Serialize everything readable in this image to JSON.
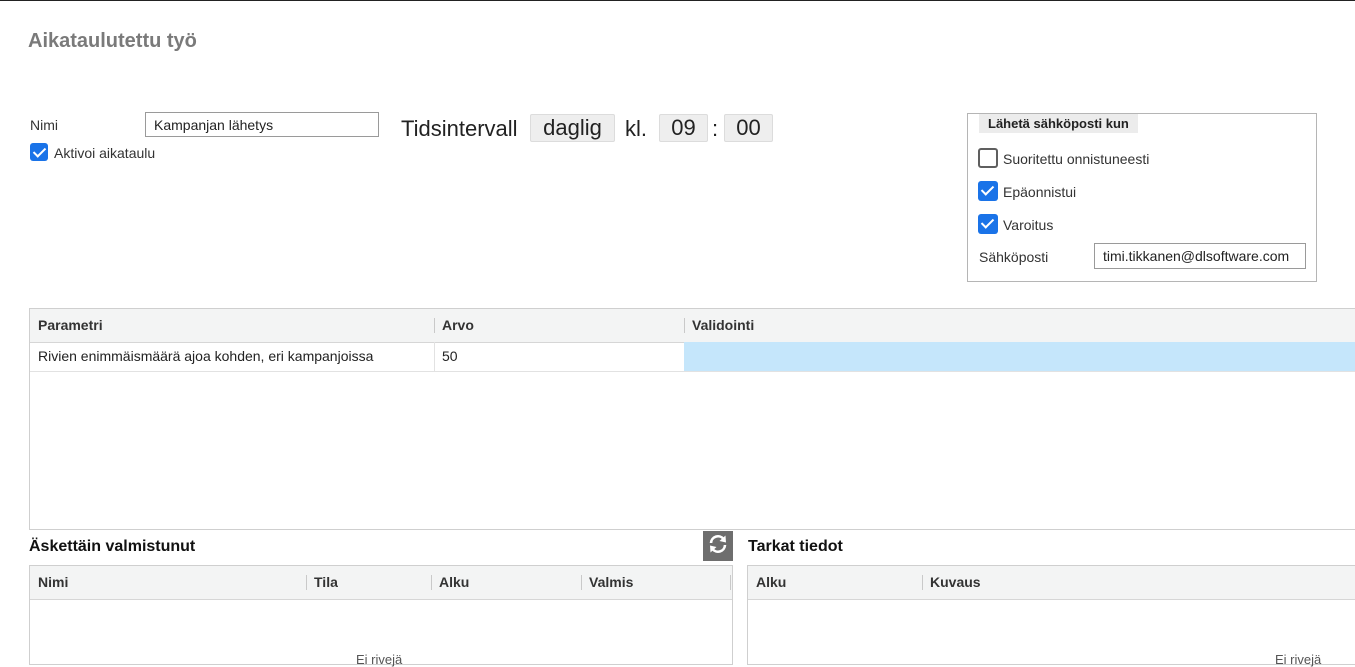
{
  "page": {
    "title": "Aikataulutettu työ"
  },
  "form": {
    "name_label": "Nimi",
    "name_value": "Kampanjan lähetys",
    "activate_label": "Aktivoi aikataulu",
    "activate_checked": true
  },
  "interval": {
    "label": "Tidsintervall",
    "frequency": "daglig",
    "time_label": "kl.",
    "hour": "09",
    "separator": ":",
    "minute": "00"
  },
  "email_group": {
    "legend": "Lähetä sähköposti kun",
    "options": [
      {
        "label": "Suoritettu onnistuneesti",
        "checked": false
      },
      {
        "label": "Epäonnistui",
        "checked": true
      },
      {
        "label": "Varoitus",
        "checked": true
      }
    ],
    "email_label": "Sähköposti",
    "email_value": "timi.tikkanen@dlsoftware.com"
  },
  "parameters": {
    "columns": [
      "Parametri",
      "Arvo",
      "Validointi"
    ],
    "rows": [
      {
        "parameter": "Rivien enimmäismäärä ajoa kohden, eri kampanjoissa",
        "value": "50",
        "validation": ""
      }
    ]
  },
  "recent": {
    "title": "Äskettäin valmistunut",
    "columns": [
      "Nimi",
      "Tila",
      "Alku",
      "Valmis"
    ],
    "empty_text": "Ei rivejä"
  },
  "details": {
    "title": "Tarkat tiedot",
    "columns": [
      "Alku",
      "Kuvaus"
    ],
    "empty_text": "Ei rivejä"
  },
  "colors": {
    "accent": "#1a73e8",
    "validation_bg": "#c5e6fb",
    "header_bg": "#f3f4f4"
  },
  "icons": {
    "refresh": "refresh-icon",
    "checkbox": "checkmark-icon"
  }
}
